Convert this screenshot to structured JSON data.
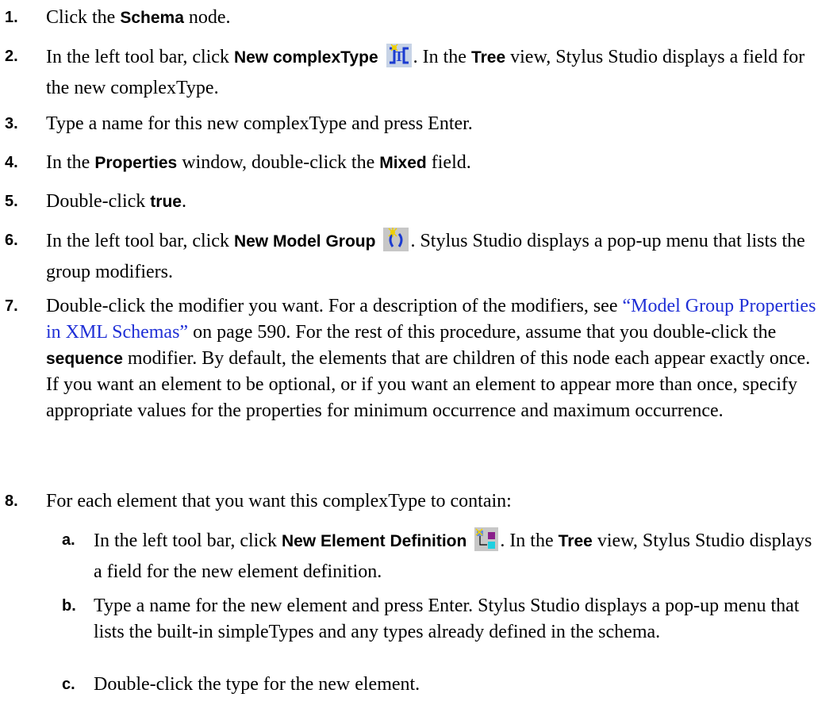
{
  "steps": [
    {
      "num": "1.",
      "parts": [
        "Click the ",
        "Schema",
        " node."
      ]
    },
    {
      "num": "2.",
      "parts": [
        "In the left tool bar, click ",
        "New complexType",
        ". In the ",
        "Tree",
        " view, Stylus Studio displays a field for the new complexType."
      ]
    },
    {
      "num": "3.",
      "parts": [
        "Type a name for this new complexType and press Enter."
      ]
    },
    {
      "num": "4.",
      "parts": [
        "In the ",
        "Properties",
        " window, double-click the ",
        "Mixed",
        " field."
      ]
    },
    {
      "num": "5.",
      "parts": [
        "Double-click ",
        "true",
        "."
      ]
    },
    {
      "num": "6.",
      "parts": [
        "In the left tool bar, click ",
        "New Model Group",
        ". Stylus Studio displays a pop-up menu that lists the group modifiers."
      ]
    },
    {
      "num": "7.",
      "parts": [
        "Double-click the modifier you want. For a description of the modifiers, see ",
        "“Model Group Properties in XML Schemas”",
        " on page 590. For the rest of this procedure, assume that you double-click the ",
        "sequence",
        " modifier. By default, the elements that are children of this node each appear exactly once. If you want an element to be optional, or if you want an element to appear more than once, specify appropriate values for the properties for minimum occurrence and maximum occurrence."
      ]
    },
    {
      "num": "8.",
      "parts": [
        "For each element that you want this complexType to contain:"
      ]
    }
  ],
  "substeps": [
    {
      "num": "a.",
      "parts": [
        "In the left tool bar, click ",
        "New Element Definition",
        ". In the ",
        "Tree",
        " view, Stylus Studio displays a field for the new element definition."
      ]
    },
    {
      "num": "b.",
      "parts": [
        "Type a name for the new element and press Enter. Stylus Studio displays a pop-up menu that lists the built-in simpleTypes and any types already defined in the schema."
      ]
    },
    {
      "num": "c.",
      "parts": [
        "Double-click the type for the new element."
      ]
    }
  ],
  "icons": {
    "new_complextype": "new-complextype-icon",
    "new_model_group": "new-model-group-icon",
    "new_element_definition": "new-element-definition-icon"
  },
  "colors": {
    "link": "#1f2fd6",
    "text": "#000000"
  }
}
